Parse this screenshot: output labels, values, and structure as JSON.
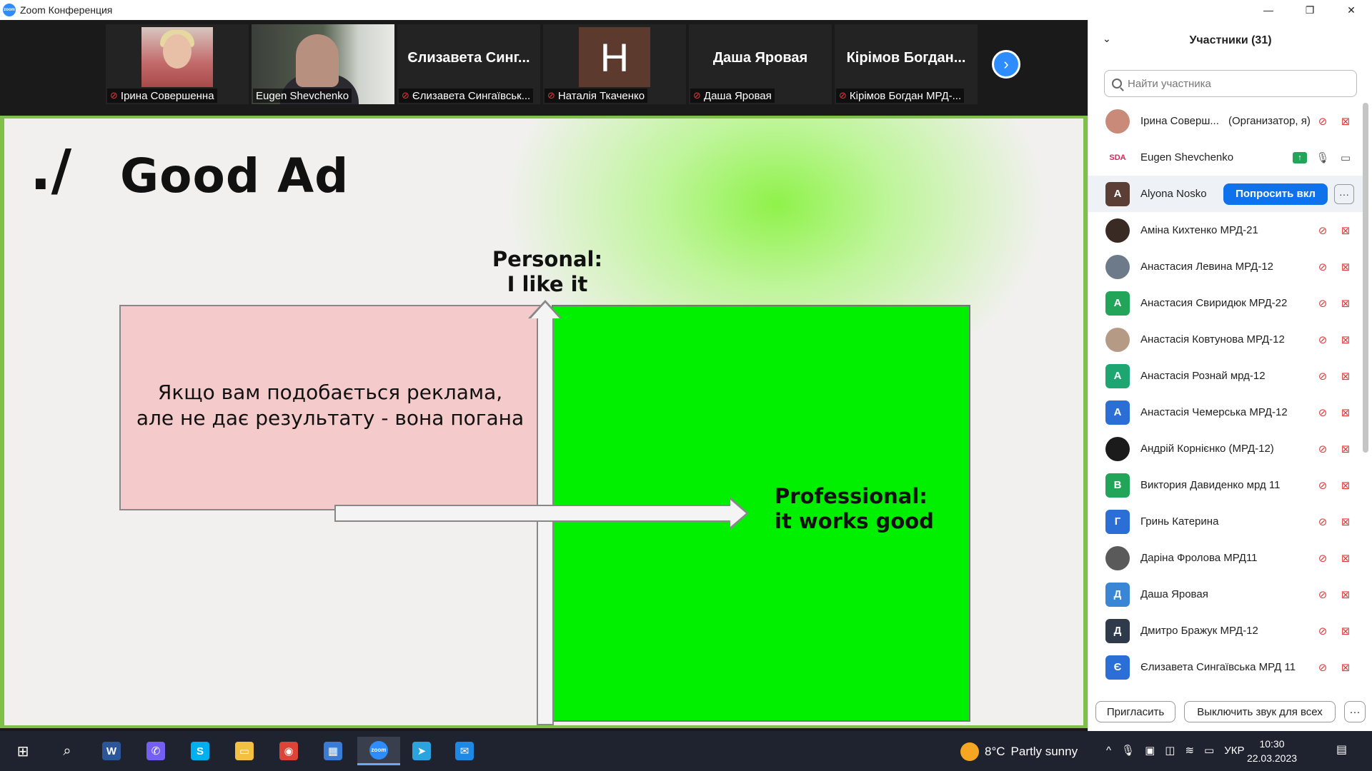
{
  "window": {
    "title": "Zoom Конференция",
    "app_icon_text": "zoom",
    "minimize_glyph": "—",
    "restore_glyph": "❐",
    "close_glyph": "✕"
  },
  "thumbnails": [
    {
      "name": "Ірина Совершенна",
      "type": "photo",
      "muted": true
    },
    {
      "name": "Eugen Shevchenko",
      "type": "video",
      "muted": false,
      "active": true
    },
    {
      "name": "Єлизавета Сингаївськ...",
      "big_name": "Єлизавета  Синг...",
      "type": "text",
      "muted": true
    },
    {
      "name": "Наталія Ткаченко",
      "avatar_letter": "H",
      "type": "avatar",
      "muted": true
    },
    {
      "name": "Даша Яровая",
      "big_name": "Даша Яровая",
      "type": "text",
      "muted": true
    },
    {
      "name": "Кірімов Богдан МРД-...",
      "big_name": "Кірімов  Богдан...",
      "type": "text",
      "muted": true
    }
  ],
  "next_glyph": "›",
  "slide": {
    "logo_mark": "./",
    "title": "Good Ad",
    "pink_text_line1": "Якщо вам подобається реклама,",
    "pink_text_line2": "але не дає результату - вона погана",
    "personal_line1": "Personal:",
    "personal_line2": "I like it",
    "professional_line1": "Professional:",
    "professional_line2": "it works good"
  },
  "participants_panel": {
    "title": "Участники (31)",
    "collapse_glyph": "⌄",
    "search_placeholder": "Найти участника",
    "ask_button_label": "Попросить вкл",
    "more_glyph": "···",
    "participants": [
      {
        "name": "Ірина Соверш...",
        "role": "(Организатор, я)",
        "avatar_type": "photo",
        "avatar_color": "#c98a7a",
        "mic": "off",
        "cam": "off"
      },
      {
        "name": "Eugen Shevchenko",
        "avatar_type": "logo",
        "avatar_text": "SDA",
        "mic": "on",
        "cam": "on",
        "sharing": true
      },
      {
        "name": "Alyona Nosko",
        "avatar_letter": "A",
        "avatar_color": "#5b3f36",
        "hover": true
      },
      {
        "name": "Аміна Кихтенко МРД-21",
        "avatar_type": "photo",
        "avatar_color": "#3a2a24",
        "mic": "off",
        "cam": "off"
      },
      {
        "name": "Анастасия Левина МРД-12",
        "avatar_type": "photo",
        "avatar_color": "#6c7a8a",
        "mic": "off",
        "cam": "off"
      },
      {
        "name": "Анастасия Свиридюк МРД-22",
        "avatar_letter": "A",
        "avatar_color": "#23a559",
        "mic": "off",
        "cam": "off"
      },
      {
        "name": "Анастасія Ковтунова МРД-12",
        "avatar_type": "photo",
        "avatar_color": "#b59a86",
        "mic": "off",
        "cam": "off"
      },
      {
        "name": "Анастасія Рознай мрд-12",
        "avatar_letter": "A",
        "avatar_color": "#1ea672",
        "mic": "off",
        "cam": "off"
      },
      {
        "name": "Анастасія Чемерська МРД-12",
        "avatar_letter": "A",
        "avatar_color": "#2b6fd6",
        "mic": "off",
        "cam": "off"
      },
      {
        "name": "Андрій Корнієнко (МРД-12)",
        "avatar_type": "photo",
        "avatar_color": "#1b1b1b",
        "mic": "off",
        "cam": "off"
      },
      {
        "name": "Виктория Давиденко мрд 11",
        "avatar_letter": "В",
        "avatar_color": "#23a559",
        "mic": "off",
        "cam": "off"
      },
      {
        "name": "Гринь Катерина",
        "avatar_letter": "Г",
        "avatar_color": "#2b6fd6",
        "mic": "off",
        "cam": "off"
      },
      {
        "name": "Даріна Фролова МРД11",
        "avatar_type": "photo",
        "avatar_color": "#5a5a5a",
        "mic": "off",
        "cam": "off"
      },
      {
        "name": "Даша Яровая",
        "avatar_letter": "Д",
        "avatar_color": "#3a86d6",
        "mic": "off",
        "cam": "off"
      },
      {
        "name": "Дмитро Бражук МРД-12",
        "avatar_letter": "Д",
        "avatar_color": "#2f3a4a",
        "mic": "off",
        "cam": "off"
      },
      {
        "name": "Єлизавета Сингаївська МРД 11",
        "avatar_letter": "Є",
        "avatar_color": "#2b6fd6",
        "mic": "off",
        "cam": "off"
      }
    ],
    "footer": {
      "invite_label": "Пригласить",
      "mute_all_label": "Выключить звук для всех",
      "more_glyph": "···"
    }
  },
  "taskbar": {
    "apps": [
      {
        "name": "windows-start",
        "glyph": "⊞"
      },
      {
        "name": "search",
        "glyph": "⌕"
      },
      {
        "name": "word",
        "glyph": "W",
        "color": "#2b579a"
      },
      {
        "name": "viber",
        "glyph": "✆",
        "color": "#7360f2"
      },
      {
        "name": "skype",
        "glyph": "S",
        "color": "#00aff0"
      },
      {
        "name": "file-explorer",
        "glyph": "▭",
        "color": "#f3c041"
      },
      {
        "name": "chrome",
        "glyph": "◉",
        "color": "#db4437"
      },
      {
        "name": "ms-store",
        "glyph": "▦",
        "color": "#3a7bd5"
      },
      {
        "name": "zoom",
        "glyph": "zoom",
        "color": "#2d8cff",
        "active": true
      },
      {
        "name": "telegram",
        "glyph": "➤",
        "color": "#2aa3de"
      },
      {
        "name": "mail",
        "glyph": "✉",
        "color": "#1e88e5"
      }
    ],
    "weather_temp": "8°C",
    "weather_text": "Partly sunny",
    "tray_chevron": "^",
    "language": "УКР",
    "time": "10:30",
    "date": "22.03.2023",
    "notification_glyph": "▤"
  }
}
